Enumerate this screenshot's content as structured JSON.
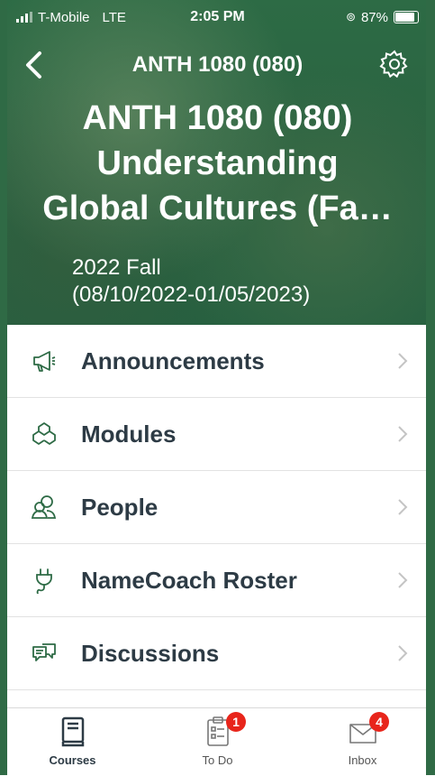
{
  "status_bar": {
    "carrier": "T-Mobile",
    "network": "LTE",
    "time": "2:05 PM",
    "battery": "87%"
  },
  "nav": {
    "title": "ANTH 1080 (080)",
    "back_icon": "chevron-left-icon",
    "settings_icon": "gear-icon"
  },
  "course": {
    "title_line1": "ANTH 1080 (080)",
    "title_line2": "Understanding",
    "title_line3": "Global Cultures (Fa…",
    "term": "2022 Fall",
    "dates": "(08/10/2022-01/05/2023)"
  },
  "menu": {
    "items": [
      {
        "label": "Announcements",
        "icon": "megaphone-icon"
      },
      {
        "label": "Modules",
        "icon": "modules-icon"
      },
      {
        "label": "People",
        "icon": "people-icon"
      },
      {
        "label": "NameCoach Roster",
        "icon": "plug-icon"
      },
      {
        "label": "Discussions",
        "icon": "discussion-icon"
      }
    ]
  },
  "tabbar": {
    "tabs": [
      {
        "label": "Courses",
        "icon": "book-icon",
        "badge": ""
      },
      {
        "label": "To Do",
        "icon": "clipboard-icon",
        "badge": "1"
      },
      {
        "label": "Inbox",
        "icon": "mail-icon",
        "badge": "4"
      }
    ]
  },
  "colors": {
    "header_green": "#2a6341",
    "text_dark": "#2d3b45",
    "icon_green": "#2e6b46",
    "badge_red": "#e8251b"
  }
}
